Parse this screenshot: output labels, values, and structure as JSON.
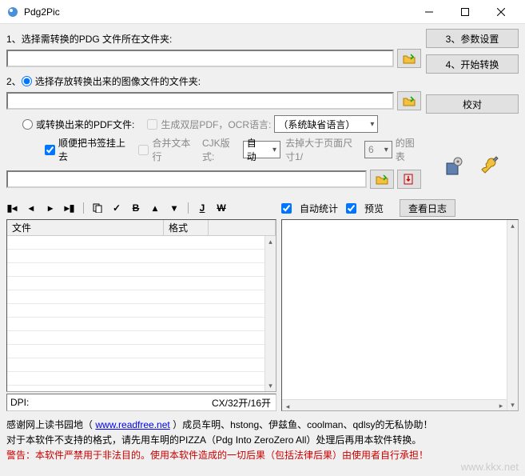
{
  "window": {
    "title": "Pdg2Pic"
  },
  "section1": {
    "num": "1、",
    "label": "选择需转换的PDG 文件所在文件夹:"
  },
  "buttons": {
    "params": "3、参数设置",
    "start": "4、开始转换",
    "proof": "校对",
    "viewlog": "查看日志"
  },
  "section2": {
    "num": "2、",
    "radio_a": "选择存放转换出来的图像文件的文件夹:",
    "radio_b": "或转换出来的PDF文件:",
    "cb_double": "生成双层PDF，OCR语言:",
    "lang_value": "（系统缺省语言）",
    "cb_bookmark": "顺便把书签挂上去",
    "cb_merge": "合并文本行",
    "cjk_label": "CJK版式:",
    "cjk_value": "自动",
    "trim_label": "去掉大于页面尺寸1/",
    "trim_value": "6",
    "trim_suffix": "的图表"
  },
  "checks": {
    "auto_stat": "自动统计",
    "preview": "预览"
  },
  "columns": {
    "file": "文件",
    "format": "格式"
  },
  "dpi": {
    "label": "DPI:",
    "cx": "CX/32开/16开"
  },
  "footer": {
    "line1_a": "感谢网上读书园地（",
    "link": "www.readfree.net",
    "line1_b": "）成员车明、hstong、伊兹鱼、coolman、qdlsy的无私协助！",
    "line2": "对于本软件不支持的格式，请先用车明的PIZZA（Pdg Into ZeroZero All）处理后再用本软件转换。",
    "line3": "警告：本软件严禁用于非法目的。使用本软件造成的一切后果（包括法律后果）由使用者自行承担！"
  },
  "watermark": "www.kkx.net",
  "toolbar_text": {
    "j": "J",
    "w": "W"
  }
}
